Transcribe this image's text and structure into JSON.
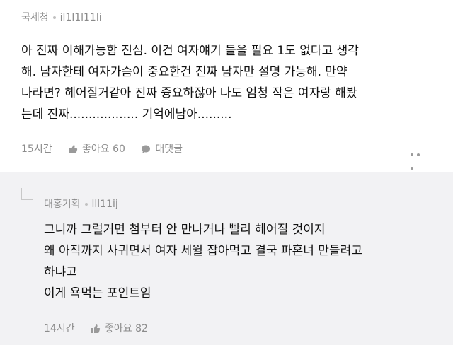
{
  "comment": {
    "author": "국세청",
    "user_id": "il1l1l11li",
    "lines": [
      "아 진짜 이해가능함 진심. 이건 여자얘기 들을 필요 1도 없다고 생각",
      "해. 남자한테 여자가슴이 중요한건 진짜 남자만 설명 가능해. 만약",
      "나라면? 헤어질거같아 진짜 즁요하잖아 나도 엄청 작은 여자랑 해봤",
      "는데 진짜.................. 기억에남아........."
    ],
    "time": "15시간",
    "like_label": "좋아요",
    "like_count": "60",
    "reply_label": "대댓글",
    "icons": [
      "thumbs-up-icon",
      "chat-bubble-icon",
      "more-icon"
    ]
  },
  "reply": {
    "author": "대홍기획",
    "user_id": "lll11ij",
    "lines": [
      "그니까 그럴거면 첨부터 안 만나거나 빨리 헤어질 것이지",
      "왜 아직까지 사귀면서 여자 세월 잡아먹고 결국 파혼녀 만들려고",
      "하냐고",
      "이게 욕먹는 포인트임"
    ],
    "time": "14시간",
    "like_label": "좋아요",
    "like_count": "82",
    "icons": [
      "reply-arrow-icon",
      "thumbs-up-icon"
    ]
  },
  "colors": {
    "reply_background": "#f2f2f4",
    "meta_text": "#8c8c8c",
    "body_text": "#111111"
  }
}
